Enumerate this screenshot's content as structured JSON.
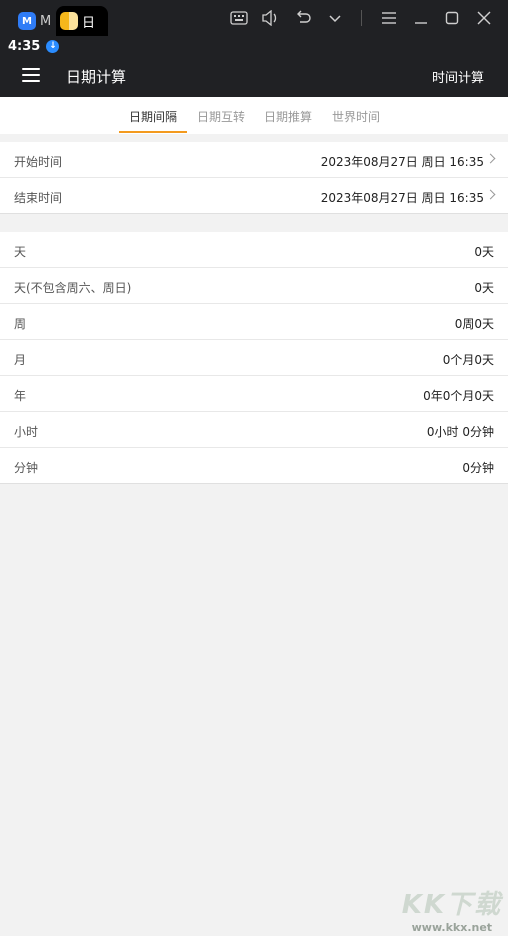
{
  "emulator": {
    "tab1_label": "M",
    "tab2_label": "日",
    "controls": [
      "keyboard-icon",
      "volume-icon",
      "undo-icon",
      "chevron-down-icon",
      "menu-icon",
      "minimize-icon",
      "maximize-icon",
      "close-icon"
    ]
  },
  "status": {
    "time": "4:35"
  },
  "toolbar": {
    "title": "日期计算",
    "action": "时间计算"
  },
  "tabs": [
    {
      "label": "日期间隔",
      "active": true
    },
    {
      "label": "日期互转",
      "active": false
    },
    {
      "label": "日期推算",
      "active": false
    },
    {
      "label": "世界时间",
      "active": false
    }
  ],
  "inputs": {
    "start": {
      "label": "开始时间",
      "value": "2023年08月27日 周日 16:35"
    },
    "end": {
      "label": "结束时间",
      "value": "2023年08月27日 周日 16:35"
    }
  },
  "results": [
    {
      "label": "天",
      "value": "0天"
    },
    {
      "label": "天(不包含周六、周日)",
      "value": "0天"
    },
    {
      "label": "周",
      "value": "0周0天"
    },
    {
      "label": "月",
      "value": "0个月0天"
    },
    {
      "label": "年",
      "value": "0年0个月0天"
    },
    {
      "label": "小时",
      "value": "0小时 0分钟"
    },
    {
      "label": "分钟",
      "value": "0分钟"
    }
  ],
  "watermark": {
    "big": "KK下载",
    "small": "www.kkx.net"
  },
  "colors": {
    "accent": "#f39a1e",
    "toolbar": "#202124"
  }
}
